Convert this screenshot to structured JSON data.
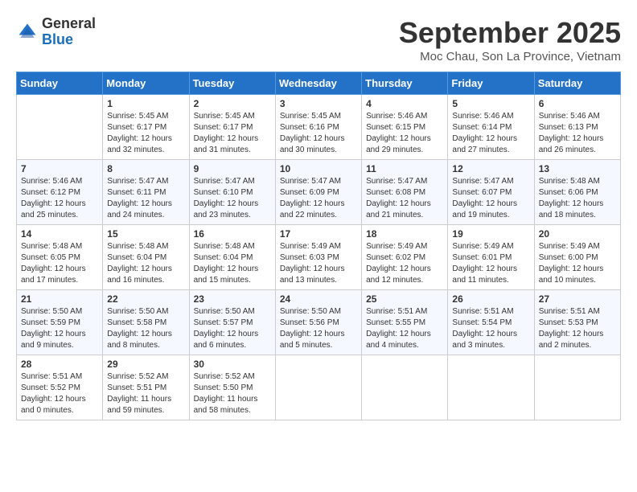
{
  "header": {
    "logo_general": "General",
    "logo_blue": "Blue",
    "month_title": "September 2025",
    "location": "Moc Chau, Son La Province, Vietnam"
  },
  "days_of_week": [
    "Sunday",
    "Monday",
    "Tuesday",
    "Wednesday",
    "Thursday",
    "Friday",
    "Saturday"
  ],
  "weeks": [
    [
      {
        "day": "",
        "content": ""
      },
      {
        "day": "1",
        "content": "Sunrise: 5:45 AM\nSunset: 6:17 PM\nDaylight: 12 hours\nand 32 minutes."
      },
      {
        "day": "2",
        "content": "Sunrise: 5:45 AM\nSunset: 6:17 PM\nDaylight: 12 hours\nand 31 minutes."
      },
      {
        "day": "3",
        "content": "Sunrise: 5:45 AM\nSunset: 6:16 PM\nDaylight: 12 hours\nand 30 minutes."
      },
      {
        "day": "4",
        "content": "Sunrise: 5:46 AM\nSunset: 6:15 PM\nDaylight: 12 hours\nand 29 minutes."
      },
      {
        "day": "5",
        "content": "Sunrise: 5:46 AM\nSunset: 6:14 PM\nDaylight: 12 hours\nand 27 minutes."
      },
      {
        "day": "6",
        "content": "Sunrise: 5:46 AM\nSunset: 6:13 PM\nDaylight: 12 hours\nand 26 minutes."
      }
    ],
    [
      {
        "day": "7",
        "content": "Sunrise: 5:46 AM\nSunset: 6:12 PM\nDaylight: 12 hours\nand 25 minutes."
      },
      {
        "day": "8",
        "content": "Sunrise: 5:47 AM\nSunset: 6:11 PM\nDaylight: 12 hours\nand 24 minutes."
      },
      {
        "day": "9",
        "content": "Sunrise: 5:47 AM\nSunset: 6:10 PM\nDaylight: 12 hours\nand 23 minutes."
      },
      {
        "day": "10",
        "content": "Sunrise: 5:47 AM\nSunset: 6:09 PM\nDaylight: 12 hours\nand 22 minutes."
      },
      {
        "day": "11",
        "content": "Sunrise: 5:47 AM\nSunset: 6:08 PM\nDaylight: 12 hours\nand 21 minutes."
      },
      {
        "day": "12",
        "content": "Sunrise: 5:47 AM\nSunset: 6:07 PM\nDaylight: 12 hours\nand 19 minutes."
      },
      {
        "day": "13",
        "content": "Sunrise: 5:48 AM\nSunset: 6:06 PM\nDaylight: 12 hours\nand 18 minutes."
      }
    ],
    [
      {
        "day": "14",
        "content": "Sunrise: 5:48 AM\nSunset: 6:05 PM\nDaylight: 12 hours\nand 17 minutes."
      },
      {
        "day": "15",
        "content": "Sunrise: 5:48 AM\nSunset: 6:04 PM\nDaylight: 12 hours\nand 16 minutes."
      },
      {
        "day": "16",
        "content": "Sunrise: 5:48 AM\nSunset: 6:04 PM\nDaylight: 12 hours\nand 15 minutes."
      },
      {
        "day": "17",
        "content": "Sunrise: 5:49 AM\nSunset: 6:03 PM\nDaylight: 12 hours\nand 13 minutes."
      },
      {
        "day": "18",
        "content": "Sunrise: 5:49 AM\nSunset: 6:02 PM\nDaylight: 12 hours\nand 12 minutes."
      },
      {
        "day": "19",
        "content": "Sunrise: 5:49 AM\nSunset: 6:01 PM\nDaylight: 12 hours\nand 11 minutes."
      },
      {
        "day": "20",
        "content": "Sunrise: 5:49 AM\nSunset: 6:00 PM\nDaylight: 12 hours\nand 10 minutes."
      }
    ],
    [
      {
        "day": "21",
        "content": "Sunrise: 5:50 AM\nSunset: 5:59 PM\nDaylight: 12 hours\nand 9 minutes."
      },
      {
        "day": "22",
        "content": "Sunrise: 5:50 AM\nSunset: 5:58 PM\nDaylight: 12 hours\nand 8 minutes."
      },
      {
        "day": "23",
        "content": "Sunrise: 5:50 AM\nSunset: 5:57 PM\nDaylight: 12 hours\nand 6 minutes."
      },
      {
        "day": "24",
        "content": "Sunrise: 5:50 AM\nSunset: 5:56 PM\nDaylight: 12 hours\nand 5 minutes."
      },
      {
        "day": "25",
        "content": "Sunrise: 5:51 AM\nSunset: 5:55 PM\nDaylight: 12 hours\nand 4 minutes."
      },
      {
        "day": "26",
        "content": "Sunrise: 5:51 AM\nSunset: 5:54 PM\nDaylight: 12 hours\nand 3 minutes."
      },
      {
        "day": "27",
        "content": "Sunrise: 5:51 AM\nSunset: 5:53 PM\nDaylight: 12 hours\nand 2 minutes."
      }
    ],
    [
      {
        "day": "28",
        "content": "Sunrise: 5:51 AM\nSunset: 5:52 PM\nDaylight: 12 hours\nand 0 minutes."
      },
      {
        "day": "29",
        "content": "Sunrise: 5:52 AM\nSunset: 5:51 PM\nDaylight: 11 hours\nand 59 minutes."
      },
      {
        "day": "30",
        "content": "Sunrise: 5:52 AM\nSunset: 5:50 PM\nDaylight: 11 hours\nand 58 minutes."
      },
      {
        "day": "",
        "content": ""
      },
      {
        "day": "",
        "content": ""
      },
      {
        "day": "",
        "content": ""
      },
      {
        "day": "",
        "content": ""
      }
    ]
  ]
}
